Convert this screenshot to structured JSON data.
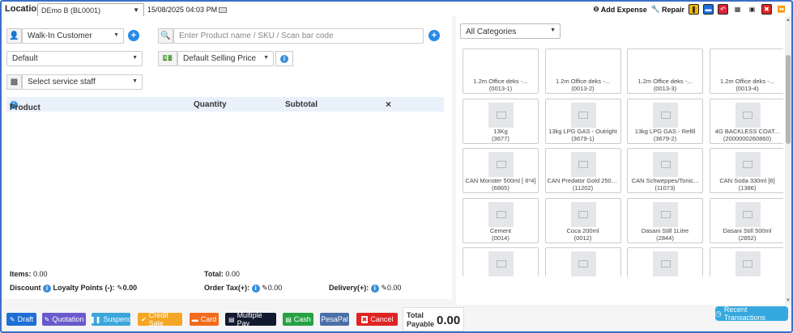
{
  "topbar": {
    "location_label": "Location:",
    "location_value": "DEmo B (BL0001)",
    "datetime": "15/08/2025 04:03 PM",
    "add_expense": "Add Expense",
    "repair": "Repair"
  },
  "form": {
    "customer": "Walk-In Customer",
    "search_placeholder": "Enter Product name / SKU / Scan bar code",
    "price_group_default": "Default",
    "selling_price": "Default Selling Price",
    "service_staff": "Select service staff"
  },
  "table": {
    "col_product": "Product",
    "col_quantity": "Quantity",
    "col_subtotal": "Subtotal",
    "col_remove": "×"
  },
  "totals": {
    "items_label": "Items:",
    "items_value": "0.00",
    "total_label": "Total:",
    "total_value": "0.00",
    "discount_label": "Discount",
    "loyalty_label": "Loyalty Points (-):",
    "loyalty_value": "0.00",
    "order_tax_label": "Order Tax(+):",
    "order_tax_value": "0.00",
    "delivery_label": "Delivery(+):",
    "delivery_value": "0.00"
  },
  "products": {
    "category": "All Categories",
    "items": [
      {
        "name": "1.2m Office deks -...",
        "sku": "(0013-1)"
      },
      {
        "name": "1.2m Office deks -...",
        "sku": "(0013-2)"
      },
      {
        "name": "1.2m Office deks -...",
        "sku": "(0013-3)"
      },
      {
        "name": "1.2m Office deks -...",
        "sku": "(0013-4)"
      },
      {
        "name": "13Kg",
        "sku": "(3677)"
      },
      {
        "name": "13kg LPG GAS - Outright",
        "sku": "(3679-1)"
      },
      {
        "name": "13kg LPG GAS - Refill",
        "sku": "(3679-2)"
      },
      {
        "name": "4G BACKLESS COAT...",
        "sku": "(2000000260860)"
      },
      {
        "name": "CAN Monster 500ml [ 6*4]",
        "sku": "(6865)"
      },
      {
        "name": "CAN Predator Gold 250ml...",
        "sku": "(11202)"
      },
      {
        "name": "CAN Schweppes/Tonic...",
        "sku": "(11073)"
      },
      {
        "name": "CAN Soda 330ml [6]",
        "sku": "(1386)"
      },
      {
        "name": "Cement",
        "sku": "(0014)"
      },
      {
        "name": "Coca 200ml",
        "sku": "(0012)"
      },
      {
        "name": "Dasani Still 1Litre",
        "sku": "(2844)"
      },
      {
        "name": "Dasani Still 500ml",
        "sku": "(2852)"
      },
      {
        "name": "",
        "sku": ""
      },
      {
        "name": "",
        "sku": ""
      },
      {
        "name": "",
        "sku": ""
      },
      {
        "name": "",
        "sku": ""
      }
    ]
  },
  "actions": {
    "draft": "Draft",
    "quotation": "Quotation",
    "suspend": "Suspend",
    "credit_sale": "Credit Sale",
    "card": "Card",
    "multiple_pay": "Multiple Pay",
    "cash": "Cash",
    "pesapal": "PesaPal",
    "cancel": "Cancel",
    "total_payable_label": "Total Payable",
    "total_payable_value": "0.00",
    "recent_transactions": "Recent Transactions"
  },
  "colors": {
    "draft": "#1e6fd6",
    "quotation": "#6a5acd",
    "suspend": "#3aa6d9",
    "credit_sale": "#f5a623",
    "card": "#f26a1b",
    "multiple_pay": "#111a2e",
    "cash": "#27a243",
    "pesapal": "#4a6fa8",
    "cancel": "#e02424"
  },
  "icons": [
    "user-icon",
    "search-icon",
    "money-icon",
    "staff-icon",
    "info-icon",
    "plus-icon",
    "calculator-icon",
    "briefcase-icon",
    "close-icon",
    "rewind-icon"
  ]
}
